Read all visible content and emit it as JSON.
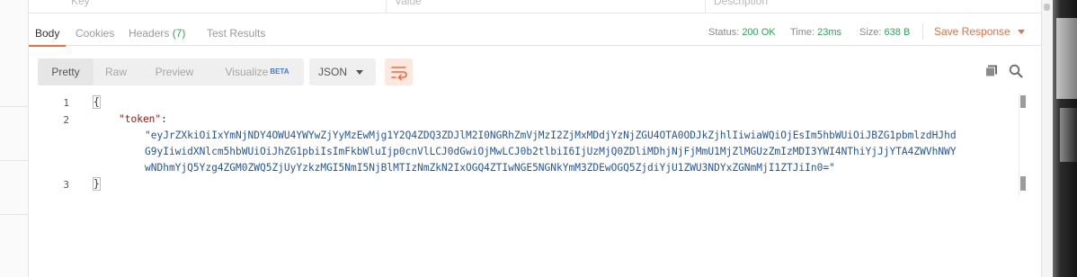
{
  "params_header": {
    "key": "Key",
    "value": "Value",
    "description": "Description"
  },
  "response_tabs": [
    {
      "label": "Body",
      "active": true
    },
    {
      "label": "Cookies",
      "active": false
    },
    {
      "label": "Headers",
      "count": "(7)",
      "active": false
    },
    {
      "label": "Test Results",
      "active": false
    }
  ],
  "status": {
    "status_label": "Status:",
    "status_value": "200 OK",
    "time_label": "Time:",
    "time_value": "23ms",
    "size_label": "Size:",
    "size_value": "638 B"
  },
  "save_response": "Save Response",
  "view_modes": [
    {
      "label": "Pretty",
      "active": true
    },
    {
      "label": "Raw",
      "active": false
    },
    {
      "label": "Preview",
      "active": false
    },
    {
      "label": "Visualize",
      "badge": "BETA",
      "active": false
    }
  ],
  "format": "JSON",
  "icons": {
    "wrap": "wrap-lines-icon",
    "copy": "copy-icon",
    "search": "search-icon"
  },
  "colors": {
    "accent": "#f26b3a",
    "status_ok": "#31a55d",
    "json_key": "#a31515",
    "json_string": "#2455a4"
  },
  "code": {
    "line_numbers": [
      "1",
      "2",
      "3"
    ],
    "open_brace": "{",
    "close_brace": "}",
    "key": "\"token\"",
    "colon": ":",
    "value_lines": [
      "\"eyJrZXkiOiIxYmNjNDY4OWU4YWYwZjYyMzEwMjg1Y2Q4ZDQ3ZDJlM2I0NGRhZmVjMzI2ZjMxMDdjYzNjZGU4OTA0ODJkZjhlIiwiaWQiOjEsIm5hbWUiOiJBZG1pbmlzdHJhd",
      "G9yIiwidXNlcm5hbWUiOiJhZG1pbiIsImFkbWluIjp0cnVlLCJ0dGwiOjMwLCJ0b2tlbiI6IjUzMjQ0ZDliMDhjNjFjMmU1MjZlMGUzZmIzMDI3YWI4NThiYjJjYTA4ZWVhNWY",
      "wNDhmYjQ5Yzg4ZGM0ZWQ5ZjUyYzkzMGI5NmI5NjBlMTIzNmZkN2IxOGQ4ZTIwNGE5NGNkYmM3ZDEwOGQ5ZjdiYjU1ZWU3NDYxZGNmMjI1ZTJiIn0=\""
    ]
  }
}
